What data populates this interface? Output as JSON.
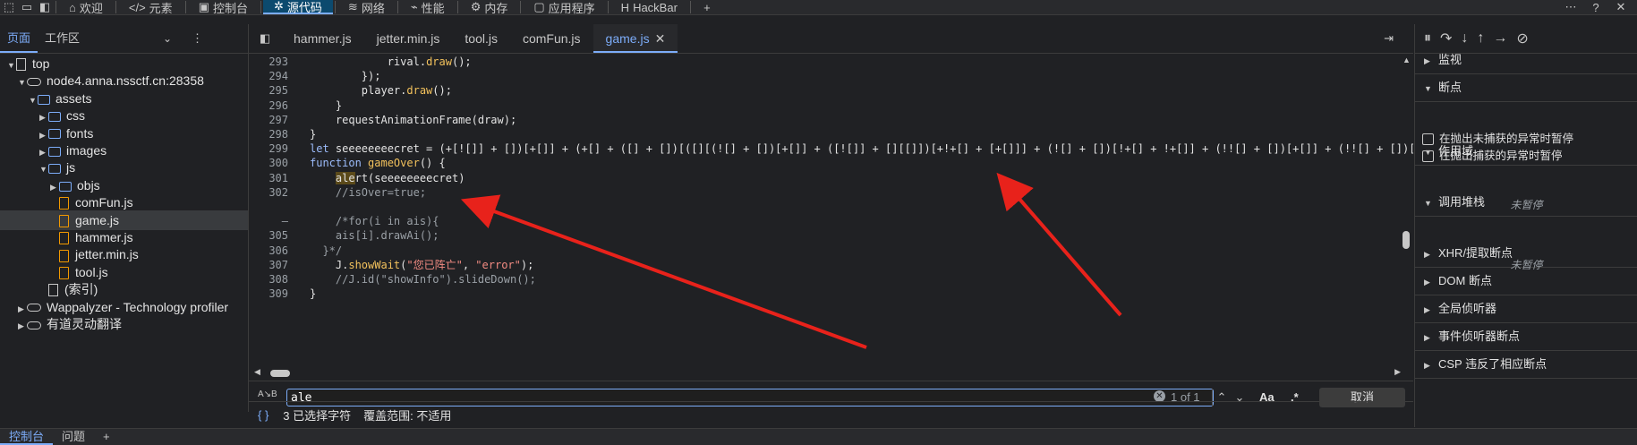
{
  "toolbar": {
    "tabs": [
      {
        "label": "欢迎",
        "icon": "home-icon"
      },
      {
        "label": "元素",
        "icon": "code-icon"
      },
      {
        "label": "控制台",
        "icon": "console-icon"
      },
      {
        "label": "源代码",
        "icon": "bug-icon"
      },
      {
        "label": "网络",
        "icon": "wifi-icon"
      },
      {
        "label": "性能",
        "icon": "performance-icon"
      },
      {
        "label": "内存",
        "icon": "memory-icon"
      },
      {
        "label": "应用程序",
        "icon": "application-icon"
      },
      {
        "label": "HackBar",
        "icon": "hackbar-icon"
      }
    ],
    "add": "+",
    "more": "⋯",
    "help": "?",
    "close": "✕"
  },
  "left": {
    "tab_page": "页面",
    "tab_workspace": "工作区",
    "tree": [
      {
        "label": "top",
        "level": 0,
        "icon": "doc",
        "arrow": "▼"
      },
      {
        "label": "node4.anna.nssctf.cn:28358",
        "level": 1,
        "icon": "cloud",
        "arrow": "▼"
      },
      {
        "label": "assets",
        "level": 2,
        "icon": "folder",
        "arrow": "▼"
      },
      {
        "label": "css",
        "level": 3,
        "icon": "folder",
        "arrow": "▶"
      },
      {
        "label": "fonts",
        "level": 3,
        "icon": "folder",
        "arrow": "▶"
      },
      {
        "label": "images",
        "level": 3,
        "icon": "folder",
        "arrow": "▶"
      },
      {
        "label": "js",
        "level": 3,
        "icon": "folder",
        "arrow": "▼"
      },
      {
        "label": "objs",
        "level": 4,
        "icon": "folder",
        "arrow": "▶"
      },
      {
        "label": "comFun.js",
        "level": 4,
        "icon": "js",
        "arrow": ""
      },
      {
        "label": "game.js",
        "level": 4,
        "icon": "js",
        "arrow": "",
        "selected": true
      },
      {
        "label": "hammer.js",
        "level": 4,
        "icon": "js",
        "arrow": ""
      },
      {
        "label": "jetter.min.js",
        "level": 4,
        "icon": "js",
        "arrow": ""
      },
      {
        "label": "tool.js",
        "level": 4,
        "icon": "js",
        "arrow": ""
      },
      {
        "label": "(索引)",
        "level": 3,
        "icon": "doc",
        "arrow": ""
      },
      {
        "label": "Wappalyzer - Technology profiler",
        "level": 1,
        "icon": "cloud",
        "arrow": "▶"
      },
      {
        "label": "有道灵动翻译",
        "level": 1,
        "icon": "cloud",
        "arrow": "▶"
      }
    ]
  },
  "files": {
    "tabs": [
      "hammer.js",
      "jetter.min.js",
      "tool.js",
      "comFun.js",
      "game.js"
    ],
    "active": "game.js",
    "close": "✕"
  },
  "code": {
    "lines": [
      {
        "n": "293",
        "indent": 6,
        "parts": [
          [
            "",
            "rival."
          ],
          [
            "fn",
            "draw"
          ],
          [
            "",
            "();"
          ]
        ]
      },
      {
        "n": "294",
        "indent": 4,
        "parts": [
          [
            "",
            "});"
          ]
        ]
      },
      {
        "n": "295",
        "indent": 4,
        "parts": [
          [
            "",
            "player."
          ],
          [
            "fn",
            "draw"
          ],
          [
            "",
            "();"
          ]
        ]
      },
      {
        "n": "296",
        "indent": 2,
        "parts": [
          [
            "",
            "}"
          ]
        ]
      },
      {
        "n": "297",
        "indent": 2,
        "parts": [
          [
            "",
            "requestAnimationFrame(draw);"
          ]
        ]
      },
      {
        "n": "298",
        "indent": 0,
        "parts": [
          [
            "",
            "}"
          ]
        ]
      },
      {
        "n": "299",
        "indent": 0,
        "parts": [
          [
            "kw",
            "let"
          ],
          [
            "",
            " seeeeeeeecret = (+[![]] + [])[+[]] + (+[] + ([] + [])[([][(![] + [])[+[]] + ([![]] + [][[]])[+!+[] + [+[]]] + (![] + [])[!+[] + !+[]] + (!![] + [])[+[]] + (!![] + [])[!+[] + !+[] + !+[]] + (!![] + [])[+!"
          ]
        ]
      },
      {
        "n": "300",
        "indent": 0,
        "parts": [
          [
            "kw",
            "function"
          ],
          [
            "",
            " "
          ],
          [
            "fn",
            "gameOver"
          ],
          [
            "",
            "() {"
          ]
        ]
      },
      {
        "n": "301",
        "indent": 2,
        "parts": [
          [
            "hl",
            "ale"
          ],
          [
            "",
            "rt(seeeeeeeecret)"
          ]
        ]
      },
      {
        "n": "302",
        "indent": 2,
        "parts": [
          [
            "cm",
            "//isOver=true;"
          ]
        ]
      },
      {
        "n": "",
        "indent": 0,
        "parts": [
          [
            "",
            ""
          ]
        ]
      },
      {
        "n": "–",
        "indent": 2,
        "parts": [
          [
            "cm",
            "/*for(i in ais){"
          ]
        ]
      },
      {
        "n": "305",
        "indent": 2,
        "parts": [
          [
            "cm",
            "ais[i].drawAi();"
          ]
        ]
      },
      {
        "n": "306",
        "indent": 1,
        "parts": [
          [
            "cm",
            "}*/"
          ]
        ]
      },
      {
        "n": "307",
        "indent": 2,
        "parts": [
          [
            "",
            "J."
          ],
          [
            "fn",
            "showWait"
          ],
          [
            "",
            "("
          ],
          [
            "str",
            "\"您已阵亡\""
          ],
          [
            "",
            ", "
          ],
          [
            "str",
            "\"error\""
          ],
          [
            "",
            ");"
          ]
        ]
      },
      {
        "n": "308",
        "indent": 2,
        "parts": [
          [
            "cm",
            "//J.id(\"showInfo\").slideDown();"
          ]
        ]
      },
      {
        "n": "309",
        "indent": 0,
        "parts": [
          [
            "",
            "}"
          ]
        ]
      }
    ]
  },
  "search": {
    "value": "ale",
    "count": "1 of 1",
    "match_case": "Aa",
    "regex": ".*",
    "cancel": "取消"
  },
  "status": {
    "braces": "{ }",
    "selection": "3 已选择字符",
    "coverage": "覆盖范围: 不适用"
  },
  "right": {
    "sections": [
      {
        "label": "监视",
        "arrow": "▶"
      },
      {
        "label": "断点",
        "arrow": "▼"
      },
      {
        "label": "作用域",
        "arrow": "▼"
      },
      {
        "label": "调用堆栈",
        "arrow": "▼"
      },
      {
        "label": "XHR/提取断点",
        "arrow": "▶"
      },
      {
        "label": "DOM 断点",
        "arrow": "▶"
      },
      {
        "label": "全局侦听器",
        "arrow": "▶"
      },
      {
        "label": "事件侦听器断点",
        "arrow": "▶"
      },
      {
        "label": "CSP 违反了相应断点",
        "arrow": "▶"
      }
    ],
    "checkbox_uncaught": "在抛出未捕获的异常时暂停",
    "checkbox_caught": "在抛出捕获的异常时暂停",
    "not_paused": "未暂停"
  },
  "bottom": {
    "tabs": [
      "控制台",
      "问题"
    ],
    "add": "+"
  },
  "colors": {
    "accent": "#7cacf8",
    "annotation": "#e8221b",
    "folder": "#7cacf8",
    "js_file": "#f29900"
  }
}
